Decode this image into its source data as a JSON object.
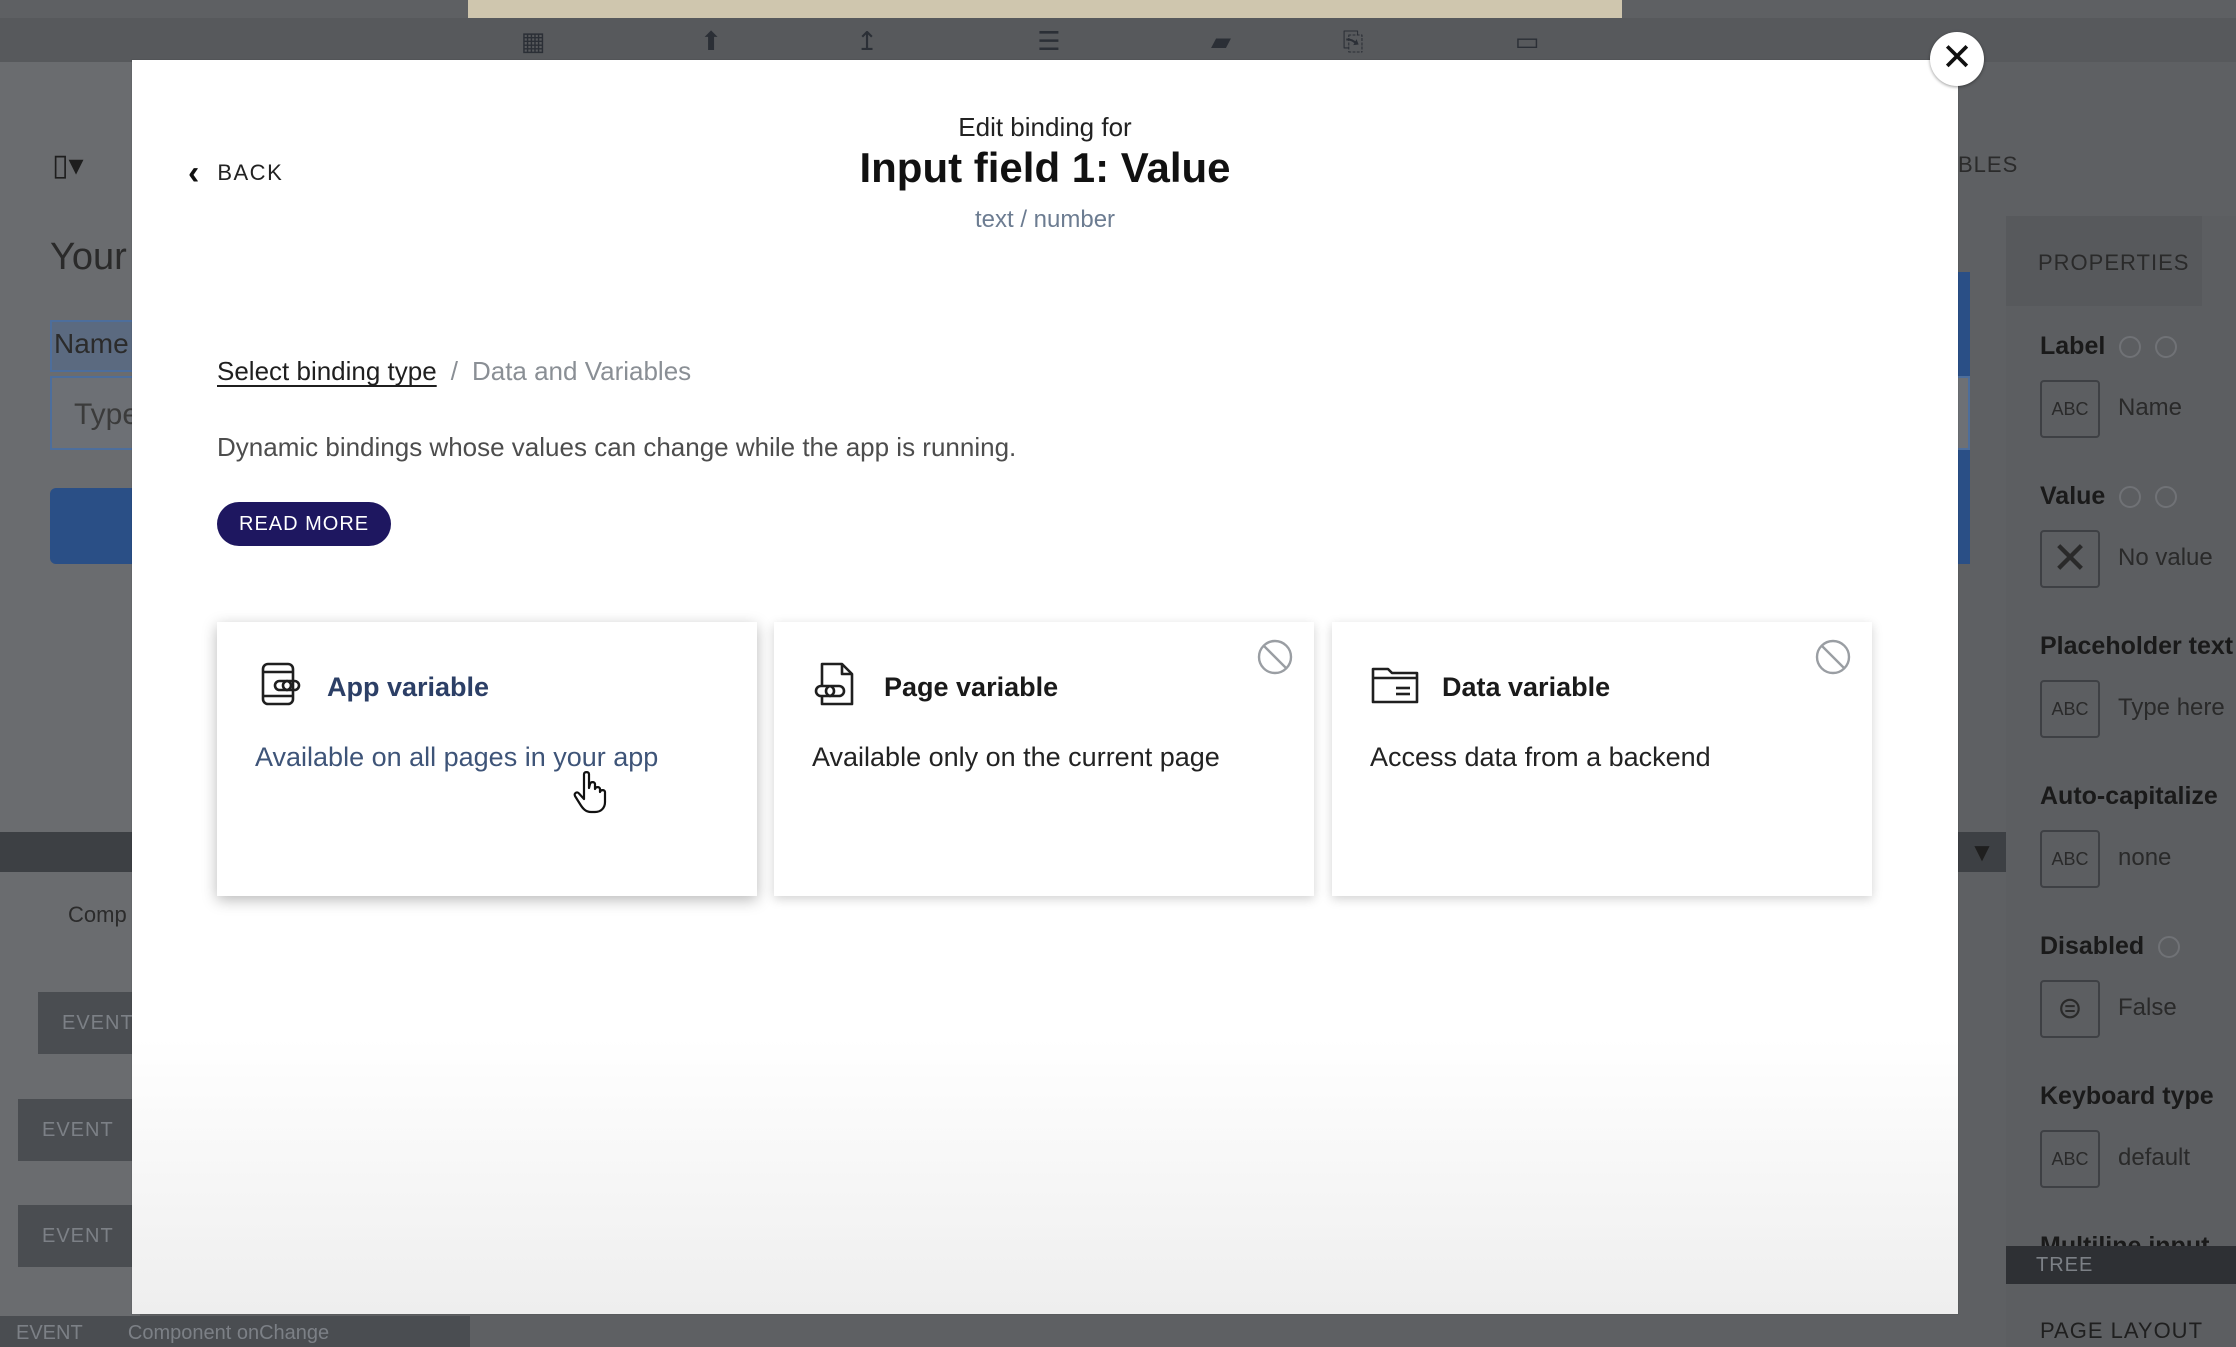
{
  "background": {
    "tabs_partial": "BLES",
    "canvas_heading_partial": "Your",
    "name_field_partial": "Name",
    "type_field_partial": "Type",
    "components_tab_partial": "Comp",
    "event_label": "EVENT",
    "bottom_event": "EVENT",
    "bottom_event_text": "Component onChange",
    "properties_tab": "PROPERTIES",
    "properties": [
      {
        "label": "Label",
        "value": "Name",
        "icon": "abc-icon"
      },
      {
        "label": "Value",
        "value": "No value",
        "icon": "x-icon"
      },
      {
        "label": "Placeholder text",
        "value": "Type here",
        "icon": "abc-icon"
      },
      {
        "label": "Auto-capitalize",
        "value": "none",
        "icon": "abc-icon"
      },
      {
        "label": "Disabled",
        "value": "False",
        "icon": "toggle-icon"
      },
      {
        "label": "Keyboard type",
        "value": "default",
        "icon": "abc-icon"
      },
      {
        "label": "Multiline input",
        "value": "",
        "icon": ""
      }
    ],
    "tree_tab": "TREE",
    "page_layout_tab": "PAGE LAYOUT",
    "abc_glyph": "ABC"
  },
  "modal": {
    "back_label": "BACK",
    "edit_binding_for": "Edit binding for",
    "title": "Input field 1: Value",
    "subtitle": "text / number",
    "breadcrumb": {
      "link": "Select binding type",
      "separator": "/",
      "current": "Data and Variables"
    },
    "description": "Dynamic bindings whose values can change while the app is running.",
    "read_more_label": "READ MORE",
    "close_icon": "close-icon",
    "cards": [
      {
        "title": "App variable",
        "description": "Available on all pages in your app",
        "icon": "app-variable-icon",
        "disabled": false
      },
      {
        "title": "Page variable",
        "description": "Available only on the current page",
        "icon": "page-variable-icon",
        "disabled": true
      },
      {
        "title": "Data variable",
        "description": "Access data from a backend",
        "icon": "data-variable-icon",
        "disabled": true
      }
    ]
  },
  "colors": {
    "read_more_bg": "#1e1760",
    "active_card_text": "#3e5478",
    "subtitle": "#6c7c91"
  }
}
